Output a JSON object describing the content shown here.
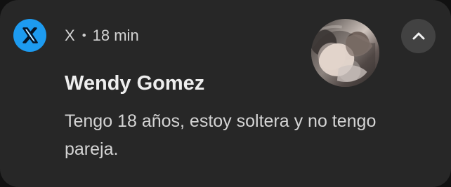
{
  "notification": {
    "app_name": "X",
    "separator": "•",
    "time": "18 min",
    "sender": "Wendy Gomez",
    "message": "Tengo 18 años, estoy soltera y no tengo pareja."
  },
  "icons": {
    "app": "x-logo-icon",
    "collapse": "chevron-up-icon"
  },
  "colors": {
    "card_background": "#272727",
    "app_icon_background": "#1d9bf0",
    "collapse_button_background": "#424242",
    "primary_text": "#eeeeee",
    "secondary_text": "#d3d3d3"
  }
}
